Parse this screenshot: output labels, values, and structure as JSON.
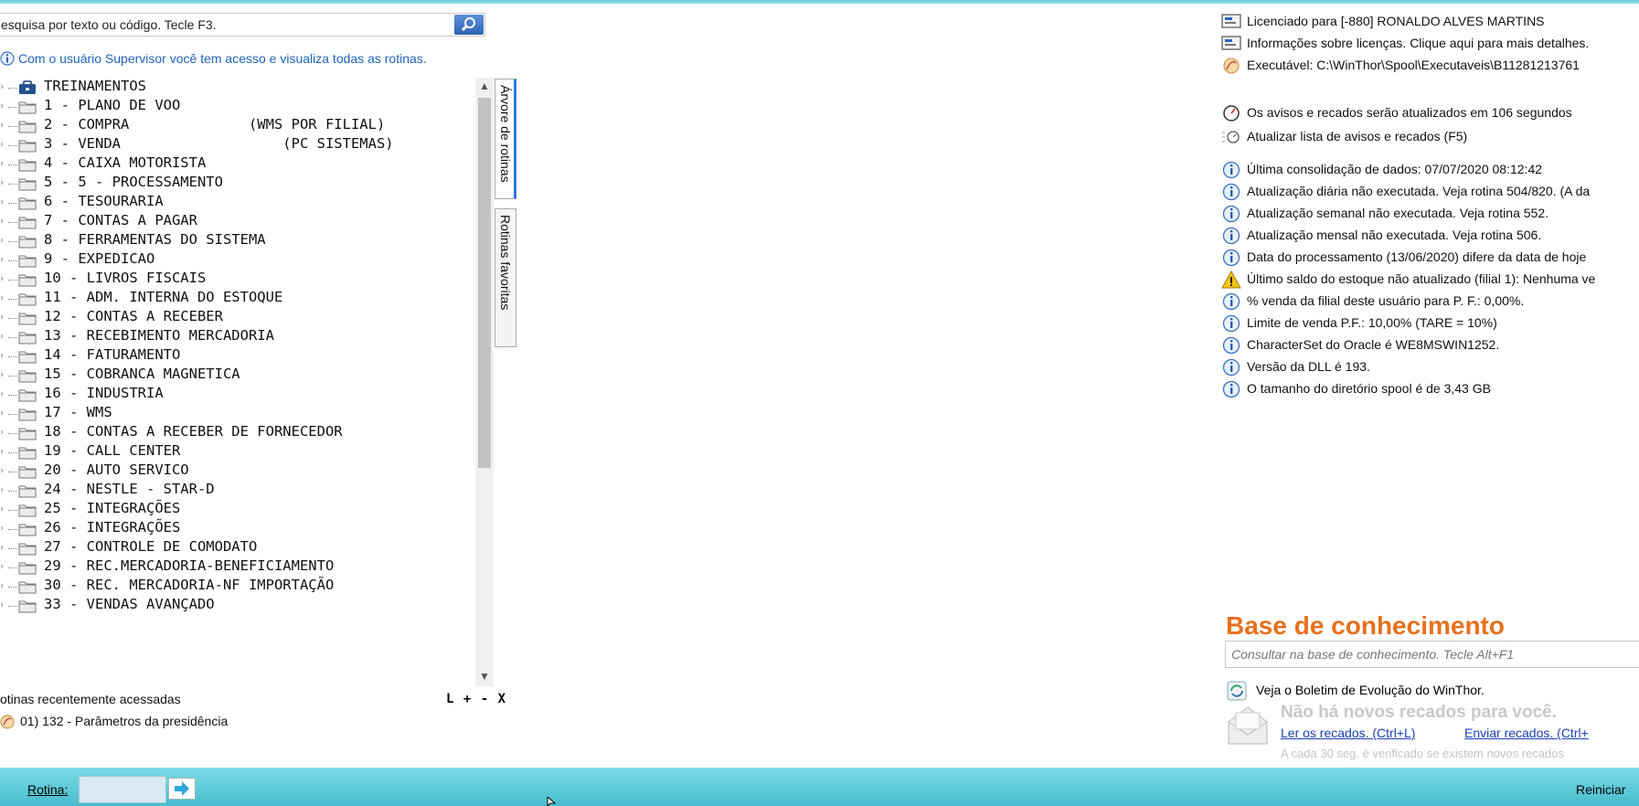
{
  "search": {
    "text": "esquisa por texto ou código. Tecle F3."
  },
  "supervisor_msg": "Com o usuário Supervisor você tem acesso e visualiza todas as rotinas.",
  "tree": [
    {
      "label": "TREINAMENTOS",
      "icon": "briefcase-icon"
    },
    {
      "label": "1 - PLANO DE VOO",
      "icon": "folder-icon"
    },
    {
      "label": "2 - COMPRA              (WMS POR FILIAL)",
      "icon": "folder-icon"
    },
    {
      "label": "3 - VENDA                   (PC SISTEMAS)",
      "icon": "folder-icon"
    },
    {
      "label": "4 - CAIXA MOTORISTA",
      "icon": "folder-icon"
    },
    {
      "label": "5 - 5 - PROCESSAMENTO",
      "icon": "folder-icon"
    },
    {
      "label": "6 - TESOURARIA",
      "icon": "folder-icon"
    },
    {
      "label": "7 - CONTAS A PAGAR",
      "icon": "folder-icon"
    },
    {
      "label": "8 - FERRAMENTAS DO SISTEMA",
      "icon": "folder-icon"
    },
    {
      "label": "9 - EXPEDICAO",
      "icon": "folder-icon"
    },
    {
      "label": "10 - LIVROS FISCAIS",
      "icon": "folder-icon"
    },
    {
      "label": "11 - ADM. INTERNA DO ESTOQUE",
      "icon": "folder-icon"
    },
    {
      "label": "12 - CONTAS A RECEBER",
      "icon": "folder-icon"
    },
    {
      "label": "13 - RECEBIMENTO MERCADORIA",
      "icon": "folder-icon"
    },
    {
      "label": "14 - FATURAMENTO",
      "icon": "folder-icon"
    },
    {
      "label": "15 - COBRANCA MAGNETICA",
      "icon": "folder-icon"
    },
    {
      "label": "16 - INDUSTRIA",
      "icon": "folder-icon"
    },
    {
      "label": "17 - WMS",
      "icon": "folder-icon"
    },
    {
      "label": "18 - CONTAS A RECEBER DE FORNECEDOR",
      "icon": "folder-icon"
    },
    {
      "label": "19 - CALL CENTER",
      "icon": "folder-icon"
    },
    {
      "label": "20 - AUTO SERVICO",
      "icon": "folder-icon"
    },
    {
      "label": "24 - NESTLE - STAR-D",
      "icon": "folder-icon"
    },
    {
      "label": "25 - INTEGRAÇÕES",
      "icon": "folder-icon"
    },
    {
      "label": "26 - INTEGRAÇÕES",
      "icon": "folder-icon"
    },
    {
      "label": "27 - CONTROLE DE COMODATO",
      "icon": "folder-icon"
    },
    {
      "label": "29 - REC.MERCADORIA-BENEFICIAMENTO",
      "icon": "folder-icon"
    },
    {
      "label": "30 - REC. MERCADORIA-NF IMPORTAÇÃO",
      "icon": "folder-icon"
    },
    {
      "label": "33 - VENDAS AVANÇADO",
      "icon": "folder-icon"
    }
  ],
  "side_tabs": [
    "Árvore de rotinas",
    "Rotinas favoritas"
  ],
  "recent": {
    "title": "otinas recentemente acessadas",
    "controls": "L + - X",
    "items": [
      "01)  132 - Parâmetros da presidência"
    ]
  },
  "info": [
    {
      "icon": "license-icon",
      "text": "Licenciado para [-880] RONALDO ALVES MARTINS"
    },
    {
      "icon": "license-icon",
      "text": "Informações sobre licenças. Clique aqui para mais detalhes."
    },
    {
      "icon": "executable-icon",
      "text": "Executável: C:\\WinThor\\Spool\\Executaveis\\B11281213761"
    },
    {
      "icon": "clock-icon",
      "text": "Os avisos e recados serão atualizados em 106 segundos"
    },
    {
      "icon": "refresh-list-icon",
      "text": "Atualizar lista de avisos e recados (F5)"
    },
    {
      "icon": "info-icon",
      "text": "Última consolidação de dados: 07/07/2020 08:12:42"
    },
    {
      "icon": "info-icon",
      "text": "Atualização diária não executada. Veja rotina 504/820. (A da"
    },
    {
      "icon": "info-icon",
      "text": "Atualização semanal não executada. Veja rotina 552."
    },
    {
      "icon": "info-icon",
      "text": "Atualização mensal não executada. Veja rotina 506."
    },
    {
      "icon": "info-icon",
      "text": "Data do processamento (13/06/2020) difere da data de hoje"
    },
    {
      "icon": "warning-icon",
      "text": "Último saldo do estoque não atualizado (filial 1): Nenhuma ve"
    },
    {
      "icon": "info-icon",
      "text": "% venda da filial deste usuário para P. F.: 0,00%."
    },
    {
      "icon": "info-icon",
      "text": "Limite de venda P.F.: 10,00% (TARE = 10%)"
    },
    {
      "icon": "info-icon",
      "text": "CharacterSet do Oracle é WE8MSWIN1252."
    },
    {
      "icon": "info-icon",
      "text": "Versão da DLL é 193."
    },
    {
      "icon": "info-icon",
      "text": "O tamanho do diretório spool é de 3,43 GB"
    }
  ],
  "knowledge": {
    "title": "Base de conhecimento",
    "placeholder": "Consultar na base de conhecimento. Tecle Alt+F1",
    "boletim": "Veja o Boletim de Evolução do WinThor.",
    "no_messages": "Não há novos recados para você.",
    "read_link": "Ler os recados. (Ctrl+L)",
    "send_link": "Enviar recados. (Ctrl+",
    "check_note": "A cada 30 seg. é verificado se existem novos recados"
  },
  "bottom": {
    "rotina_label": "Rotina:",
    "restart": "Reiniciar"
  },
  "colors": {
    "accent": "#1e63b8",
    "kb_title": "#e6701e",
    "bottom_bar": "#47bccd"
  }
}
